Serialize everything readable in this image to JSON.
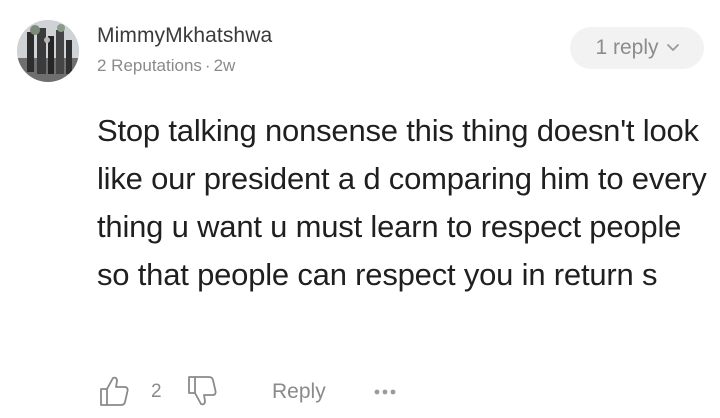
{
  "comment": {
    "username": "MimmyMkhatshwa",
    "reputation": "2 Reputations",
    "separator": "·",
    "age": "2w",
    "reply_pill_label": "1 reply",
    "text": "Stop talking nonsense this thing doesn't look like our president a d comparing him to every thing u want u must learn to respect people so that people can respect you in return s",
    "likes": "2",
    "reply_label": "Reply",
    "icons": {
      "avatar": "user-avatar",
      "reply_chevron": "chevron-down-icon",
      "like": "thumbs-up-icon",
      "dislike": "thumbs-down-icon",
      "more": "more-dots-icon"
    }
  },
  "colors": {
    "text": "#1f1f1f",
    "muted": "#8a8a8a",
    "pill_bg": "#f2f2f2"
  }
}
